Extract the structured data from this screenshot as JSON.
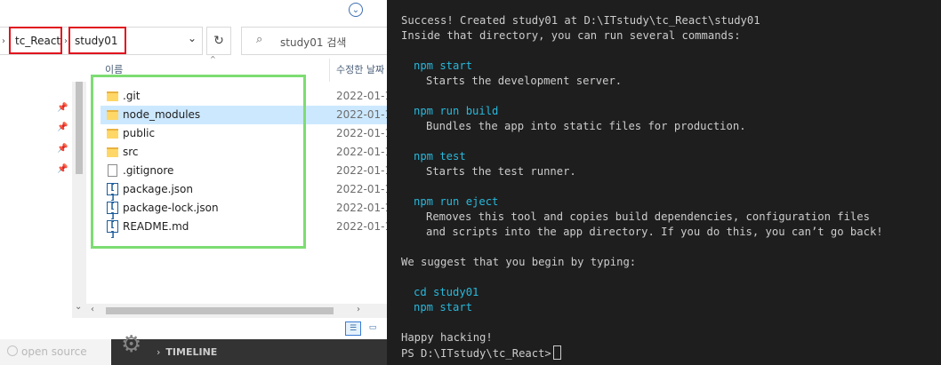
{
  "explorer": {
    "breadcrumb": [
      "tc_React",
      "study01"
    ],
    "search_placeholder": "study01 검색",
    "columns": {
      "name": "이름",
      "date": "수정한 날짜"
    },
    "files": [
      {
        "name": ".git",
        "type": "folder",
        "date": "2022-01-1"
      },
      {
        "name": "node_modules",
        "type": "folder",
        "date": "2022-01-1",
        "selected": true
      },
      {
        "name": "public",
        "type": "folder",
        "date": "2022-01-1"
      },
      {
        "name": "src",
        "type": "folder",
        "date": "2022-01-1"
      },
      {
        "name": ".gitignore",
        "type": "file",
        "date": "2022-01-1"
      },
      {
        "name": "package.json",
        "type": "json",
        "date": "2022-01-1"
      },
      {
        "name": "package-lock.json",
        "type": "json",
        "date": "2022-01-1"
      },
      {
        "name": "README.md",
        "type": "json",
        "date": "2022-01-1"
      }
    ],
    "highlight_colors": {
      "red": "#e0141e",
      "green": "#7ddc72"
    }
  },
  "behind": {
    "left_label": "open source",
    "panel_title": "TIMELINE"
  },
  "terminal": {
    "lines": [
      {
        "text": "Success! Created study01 at D:\\ITstudy\\tc_React\\study01",
        "indent": 0,
        "cmd": false
      },
      {
        "text": "Inside that directory, you can run several commands:",
        "indent": 0,
        "cmd": false
      },
      {
        "text": "",
        "indent": 0,
        "cmd": false
      },
      {
        "text": "npm start",
        "indent": 1,
        "cmd": true
      },
      {
        "text": "Starts the development server.",
        "indent": 2,
        "cmd": false
      },
      {
        "text": "",
        "indent": 0,
        "cmd": false
      },
      {
        "text": "npm run build",
        "indent": 1,
        "cmd": true
      },
      {
        "text": "Bundles the app into static files for production.",
        "indent": 2,
        "cmd": false
      },
      {
        "text": "",
        "indent": 0,
        "cmd": false
      },
      {
        "text": "npm test",
        "indent": 1,
        "cmd": true
      },
      {
        "text": "Starts the test runner.",
        "indent": 2,
        "cmd": false
      },
      {
        "text": "",
        "indent": 0,
        "cmd": false
      },
      {
        "text": "npm run eject",
        "indent": 1,
        "cmd": true
      },
      {
        "text": "Removes this tool and copies build dependencies, configuration files",
        "indent": 2,
        "cmd": false
      },
      {
        "text": "and scripts into the app directory. If you do this, you can’t go back!",
        "indent": 2,
        "cmd": false
      },
      {
        "text": "",
        "indent": 0,
        "cmd": false
      },
      {
        "text": "We suggest that you begin by typing:",
        "indent": 0,
        "cmd": false
      },
      {
        "text": "",
        "indent": 0,
        "cmd": false
      },
      {
        "text": "cd study01",
        "indent": 1,
        "cmd": true
      },
      {
        "text": "npm start",
        "indent": 1,
        "cmd": true
      },
      {
        "text": "",
        "indent": 0,
        "cmd": false
      },
      {
        "text": "Happy hacking!",
        "indent": 0,
        "cmd": false
      }
    ],
    "prompt": "PS D:\\ITstudy\\tc_React>",
    "colors": {
      "text": "#cccccc",
      "command": "#29b8db",
      "background": "#1e1e1e"
    }
  }
}
